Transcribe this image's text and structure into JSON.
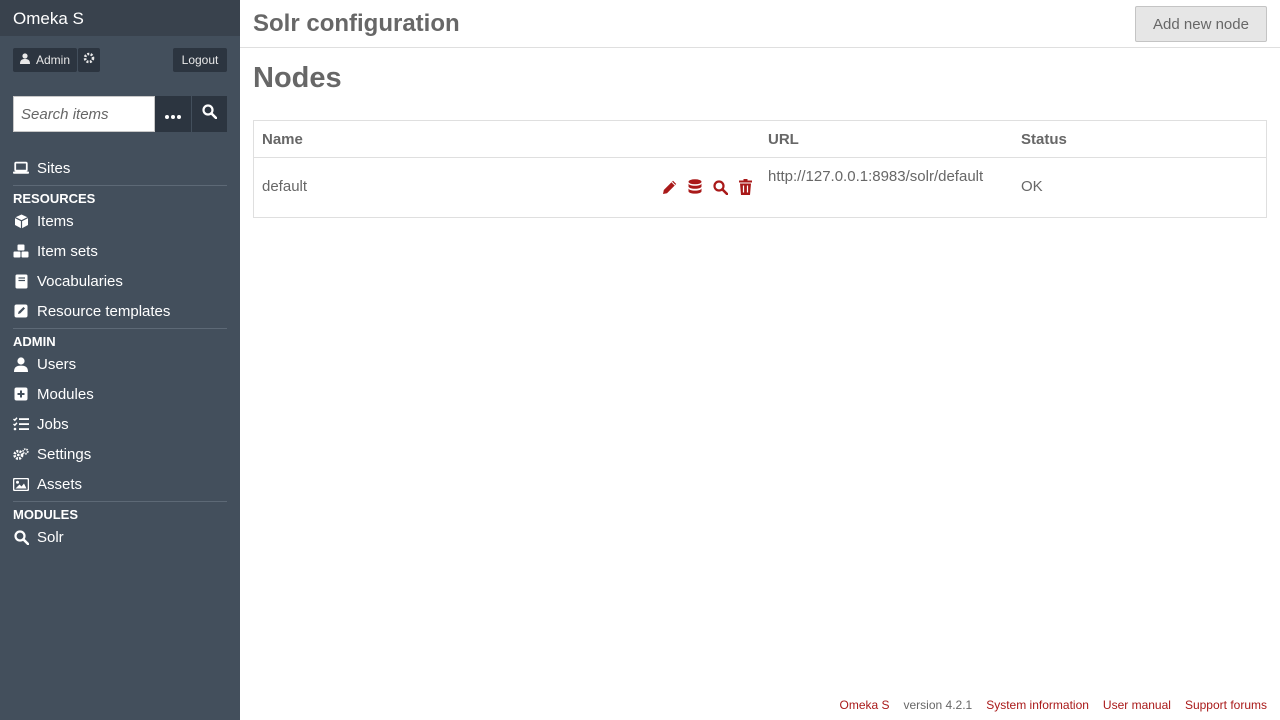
{
  "brand": "Omeka S",
  "user": {
    "name": "Admin",
    "logout_label": "Logout"
  },
  "search": {
    "placeholder": "Search items"
  },
  "nav": {
    "sites": "Sites",
    "resources_heading": "Resources",
    "items": "Items",
    "item_sets": "Item sets",
    "vocabularies": "Vocabularies",
    "resource_templates": "Resource templates",
    "admin_heading": "Admin",
    "users": "Users",
    "modules": "Modules",
    "jobs": "Jobs",
    "settings": "Settings",
    "assets": "Assets",
    "modules_heading": "Modules",
    "solr": "Solr"
  },
  "header": {
    "title": "Solr configuration",
    "add_button": "Add new node"
  },
  "section_title": "Nodes",
  "table": {
    "columns": [
      "Name",
      "URL",
      "Status"
    ],
    "rows": [
      {
        "name": "default",
        "url": "http://127.0.0.1:8983/solr/default",
        "status": "OK"
      }
    ]
  },
  "row_action_icons": [
    "pencil-icon",
    "database-icon",
    "search-icon",
    "trash-icon"
  ],
  "footer": {
    "omeka": "Omeka S",
    "version": "version 4.2.1",
    "system_info": "System information",
    "user_manual": "User manual",
    "support": "Support forums"
  },
  "colors": {
    "sidebar": "#434f5c",
    "accent": "#a91919",
    "text": "#676767"
  }
}
